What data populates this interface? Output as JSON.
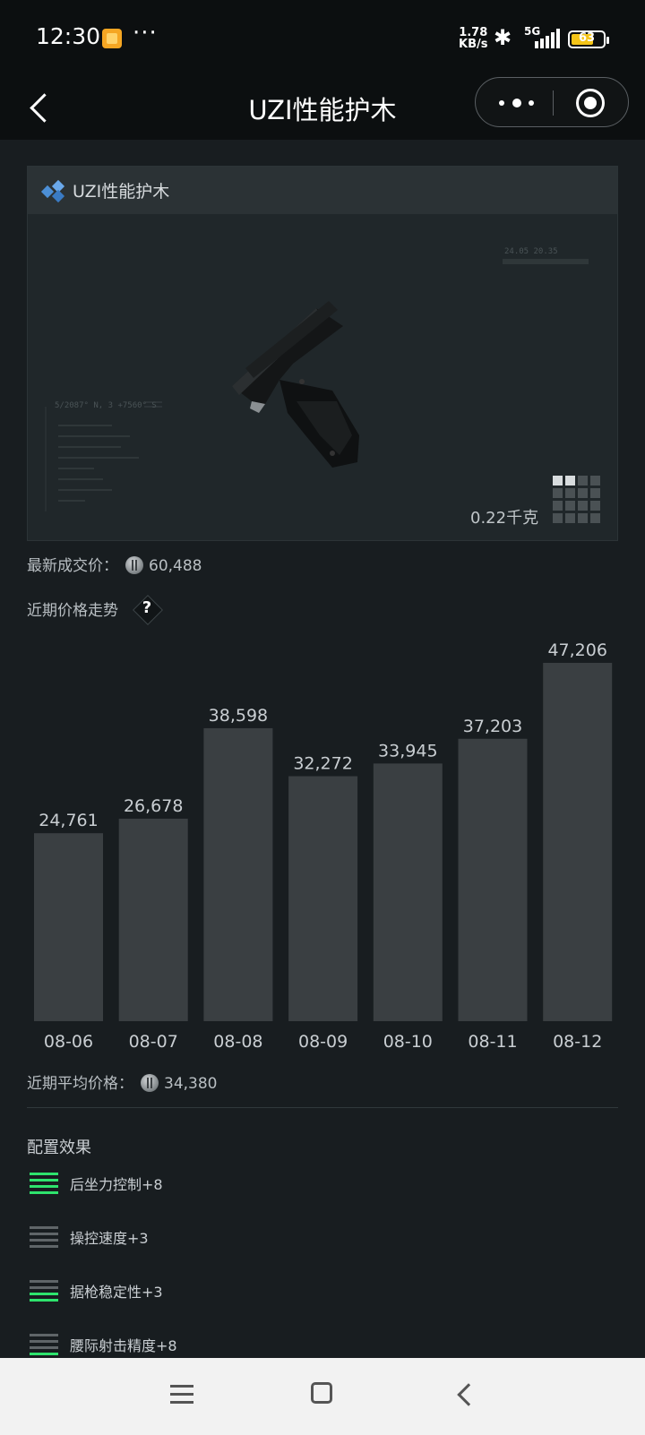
{
  "status_bar": {
    "time": "12:30",
    "dots": "···",
    "speed_value": "1.78",
    "speed_unit": "KB/s",
    "network": "5G",
    "battery": "63"
  },
  "nav": {
    "title": "UZI性能护木"
  },
  "item_card": {
    "title": "UZI性能护木",
    "weight": "0.22千克",
    "hud_line": "5/2087° N, 3 +7560° S",
    "hud_top": "24.05   20.35"
  },
  "latest_price": {
    "label": "最新成交价：",
    "value": "60,488"
  },
  "trend": {
    "label": "近期价格走势",
    "help_icon": "?"
  },
  "chart_data": {
    "type": "bar",
    "categories": [
      "08-06",
      "08-07",
      "08-08",
      "08-09",
      "08-10",
      "08-11",
      "08-12"
    ],
    "values": [
      24761,
      26678,
      38598,
      32272,
      33945,
      37203,
      47206
    ],
    "value_labels": [
      "24,761",
      "26,678",
      "38,598",
      "32,272",
      "33,945",
      "37,203",
      "47,206"
    ],
    "bar_color": "#3a3f42",
    "label_color": "#c9ced2"
  },
  "average_price": {
    "label": "近期平均价格：",
    "value": "34,380"
  },
  "config": {
    "title": "配置效果",
    "effects": [
      {
        "label": "后坐力控制+8",
        "level": 4,
        "filled": 4
      },
      {
        "label": "操控速度+3",
        "level": 4,
        "filled": 0
      },
      {
        "label": "据枪稳定性+3",
        "level": 4,
        "filled": 2
      },
      {
        "label": "腰际射击精度+8",
        "level": 4,
        "filled": 1
      }
    ],
    "accent_color": "#2ee36d"
  }
}
